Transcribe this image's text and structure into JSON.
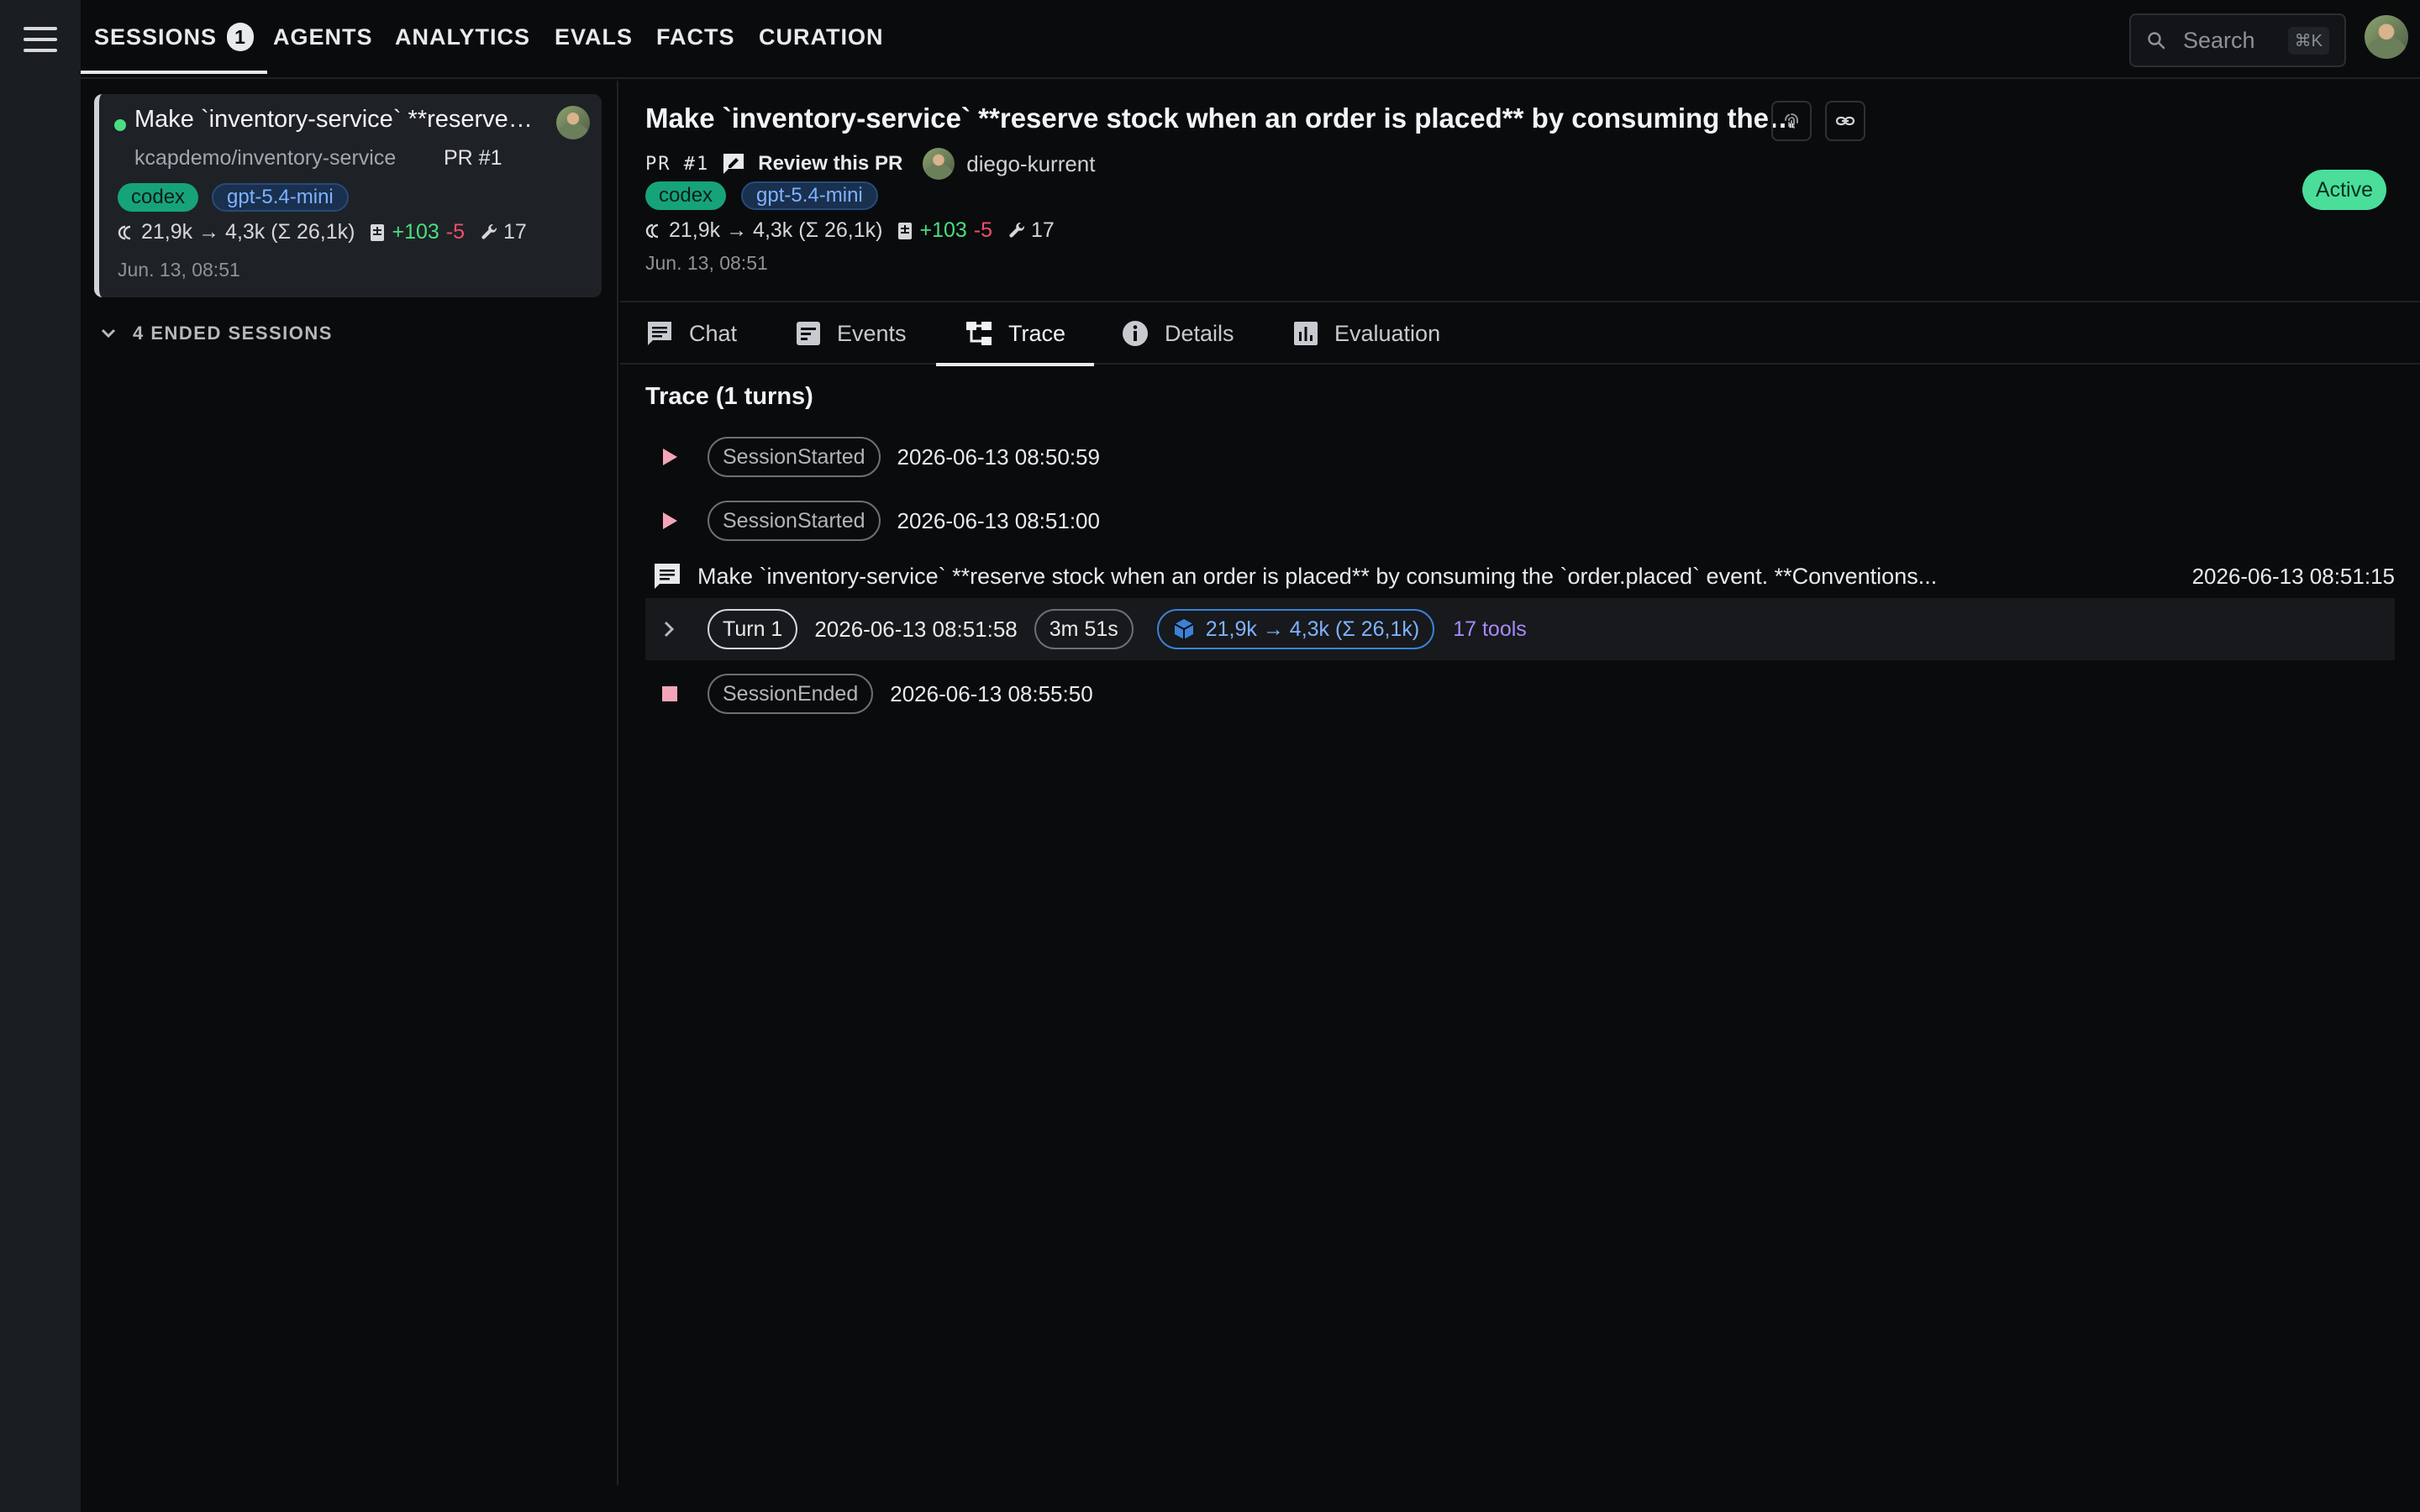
{
  "nav": {
    "tabs": [
      {
        "label": "SESSIONS",
        "count": "1"
      },
      {
        "label": "AGENTS"
      },
      {
        "label": "ANALYTICS"
      },
      {
        "label": "EVALS"
      },
      {
        "label": "FACTS"
      },
      {
        "label": "CURATION"
      }
    ],
    "search_placeholder": "Search",
    "search_shortcut": "⌘K"
  },
  "sidebar": {
    "session": {
      "title": "Make `inventory-service` **reserve stock when an order is placed** by consuming the `order.placed` event.",
      "repo": "kcapdemo/inventory-service",
      "pr": "PR #1",
      "agent": "codex",
      "model": "gpt-5.4-mini",
      "tokens": "21,9k → 4,3k (Σ 26,1k)",
      "added": "+103",
      "removed": "-5",
      "tools": "17",
      "date": "Jun. 13, 08:51"
    },
    "ended_label": "4 ENDED SESSIONS"
  },
  "main": {
    "title": "Make `inventory-service` **reserve stock when an order is placed** by consuming the `order.placed` event.",
    "pr_label": "PR #1",
    "review_label": "Review this PR",
    "user": "diego-kurrent",
    "agent": "codex",
    "model": "gpt-5.4-mini",
    "tokens": "21,9k → 4,3k (Σ 26,1k)",
    "added": "+103",
    "removed": "-5",
    "tools": "17",
    "date": "Jun. 13, 08:51",
    "status": "Active",
    "tabs": [
      "Chat",
      "Events",
      "Trace",
      "Details",
      "Evaluation"
    ],
    "active_tab": "Trace"
  },
  "trace": {
    "heading": "Trace (1 turns)",
    "rows": [
      {
        "type": "SessionStarted",
        "ts": "2026-06-13 08:50:59"
      },
      {
        "type": "SessionStarted",
        "ts": "2026-06-13 08:51:00"
      },
      {
        "type": "message",
        "text": "Make `inventory-service` **reserve stock when an order is placed** by consuming the `order.placed` event. **Conventions...",
        "ts": "2026-06-13 08:51:15"
      },
      {
        "type": "Turn 1",
        "ts": "2026-06-13 08:51:58",
        "duration": "3m 51s",
        "tokens": "21,9k → 4,3k (Σ 26,1k)",
        "tools": "17 tools"
      },
      {
        "type": "SessionEnded",
        "ts": "2026-06-13 08:55:50"
      }
    ]
  },
  "colors": {
    "accent_green": "#4ade80",
    "removed_red": "#ef4f6b",
    "token_blue": "#7fb2ff",
    "tools_purple": "#a78bfa"
  }
}
